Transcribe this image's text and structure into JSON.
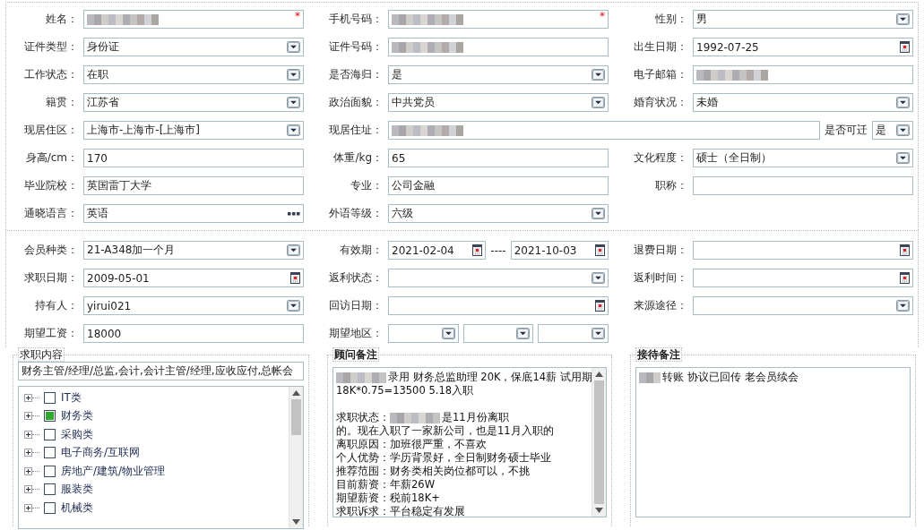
{
  "sections": [
    {
      "cells": [
        {
          "label": "姓名：",
          "controls": [
            {
              "kind": "text",
              "blurred": true,
              "required_mark": "*"
            }
          ]
        },
        {
          "label": "手机号码：",
          "controls": [
            {
              "kind": "text",
              "blurred": true,
              "required_mark": "*"
            }
          ]
        },
        {
          "label": "性别：",
          "controls": [
            {
              "kind": "select",
              "value": "男"
            }
          ]
        },
        {
          "label": "证件类型：",
          "controls": [
            {
              "kind": "select",
              "value": "身份证"
            }
          ]
        },
        {
          "label": "证件号码：",
          "controls": [
            {
              "kind": "text",
              "blurred": true
            }
          ]
        },
        {
          "label": "出生日期：",
          "controls": [
            {
              "kind": "date",
              "value": "1992-07-25"
            }
          ]
        },
        {
          "label": "工作状态：",
          "controls": [
            {
              "kind": "select",
              "value": "在职"
            }
          ]
        },
        {
          "label": "是否海归：",
          "controls": [
            {
              "kind": "select",
              "value": "是"
            }
          ]
        },
        {
          "label": "电子邮箱：",
          "controls": [
            {
              "kind": "text",
              "blurred": true
            }
          ]
        },
        {
          "label": "籍贯：",
          "controls": [
            {
              "kind": "select",
              "value": "江苏省"
            }
          ]
        },
        {
          "label": "政治面貌：",
          "controls": [
            {
              "kind": "select",
              "value": "中共党员"
            }
          ]
        },
        {
          "label": "婚育状况：",
          "controls": [
            {
              "kind": "select",
              "value": "未婚"
            }
          ]
        },
        {
          "label": "现居住区：",
          "controls": [
            {
              "kind": "select",
              "value": "上海市-上海市-[上海市]"
            }
          ]
        },
        {
          "label": "现居住址：",
          "wide": true,
          "controls": [
            {
              "kind": "text",
              "blurred": true
            },
            {
              "kind": "label",
              "text": "是否可迁"
            },
            {
              "kind": "select",
              "value": "是",
              "compact": true
            }
          ]
        },
        {
          "label": "身高/cm：",
          "controls": [
            {
              "kind": "text",
              "value": "170"
            }
          ]
        },
        {
          "label": "体重/kg：",
          "controls": [
            {
              "kind": "text",
              "value": "65"
            }
          ]
        },
        {
          "label": "文化程度：",
          "controls": [
            {
              "kind": "select",
              "value": "硕士（全日制）"
            }
          ]
        },
        {
          "label": "毕业院校：",
          "controls": [
            {
              "kind": "text",
              "value": "英国雷丁大学"
            }
          ]
        },
        {
          "label": "专业：",
          "controls": [
            {
              "kind": "text",
              "value": "公司金融"
            }
          ]
        },
        {
          "label": "职称：",
          "controls": [
            {
              "kind": "text"
            }
          ]
        },
        {
          "label": "通晓语言：",
          "controls": [
            {
              "kind": "lookup",
              "value": "英语"
            }
          ]
        },
        {
          "label": "外语等级：",
          "controls": [
            {
              "kind": "select",
              "value": "六级"
            }
          ]
        }
      ]
    },
    {
      "cells": [
        {
          "label": "会员种类：",
          "controls": [
            {
              "kind": "select",
              "value": "21-A348加一个月"
            }
          ]
        },
        {
          "label": "有效期：",
          "controls": [
            {
              "kind": "date",
              "value": "2021-02-04"
            },
            {
              "kind": "label",
              "text": "----"
            },
            {
              "kind": "date",
              "value": "2021-10-03"
            }
          ]
        },
        {
          "label": "退费日期：",
          "controls": [
            {
              "kind": "date"
            }
          ]
        },
        {
          "label": "求职日期：",
          "controls": [
            {
              "kind": "date",
              "value": "2009-05-01"
            }
          ]
        },
        {
          "label": "返利状态：",
          "controls": [
            {
              "kind": "select"
            }
          ]
        },
        {
          "label": "返利时间：",
          "controls": [
            {
              "kind": "date"
            }
          ]
        },
        {
          "label": "持有人：",
          "controls": [
            {
              "kind": "select",
              "value": "yirui021"
            }
          ]
        },
        {
          "label": "回访日期：",
          "controls": [
            {
              "kind": "date"
            }
          ]
        },
        {
          "label": "来源途径：",
          "controls": [
            {
              "kind": "select"
            }
          ]
        },
        {
          "label": "期望工资：",
          "controls": [
            {
              "kind": "text",
              "value": "18000"
            }
          ]
        },
        {
          "label": "期望地区：",
          "controls": [
            {
              "kind": "select"
            },
            {
              "kind": "select"
            },
            {
              "kind": "select"
            }
          ]
        }
      ]
    }
  ],
  "job_content": {
    "title": "求职内容",
    "summary": "财务主管/经理/总监,会计,会计主管/经理,应收应付,总帐会",
    "tree": [
      {
        "label": "IT类",
        "checked": false,
        "expanded": false
      },
      {
        "label": "财务类",
        "checked": true,
        "expanded": false
      },
      {
        "label": "采购类",
        "checked": false,
        "expanded": false
      },
      {
        "label": "电子商务/互联网",
        "checked": false,
        "expanded": false
      },
      {
        "label": "房地产/建筑/物业管理",
        "checked": false,
        "expanded": false
      },
      {
        "label": "服装类",
        "checked": false,
        "expanded": false
      },
      {
        "label": "机械类",
        "checked": false,
        "expanded": false
      }
    ]
  },
  "advisor_notes": {
    "title": "顾问备注",
    "lines": [
      {
        "kind": "text",
        "parts": [
          {
            "kind": "blur"
          },
          {
            "kind": "text",
            "text": "录用 财务总监助理  20K，保底14薪 试用期"
          }
        ]
      },
      {
        "kind": "text",
        "parts": [
          {
            "kind": "text",
            "text": "18K*0.75=13500  5.18入职"
          }
        ]
      },
      {
        "kind": "blank"
      },
      {
        "kind": "text",
        "parts": [
          {
            "kind": "text",
            "text": "求职状态："
          },
          {
            "kind": "blur"
          },
          {
            "kind": "text",
            "text": "是11月份离职"
          }
        ]
      },
      {
        "kind": "text",
        "parts": [
          {
            "kind": "text",
            "text": "的。现在入职了一家新公司，也是11月入职的"
          }
        ]
      },
      {
        "kind": "text",
        "parts": [
          {
            "kind": "text",
            "text": "离职原因：加班很严重，不喜欢"
          }
        ]
      },
      {
        "kind": "text",
        "parts": [
          {
            "kind": "text",
            "text": "个人优势：学历背景好，全日制财务硕士毕业"
          }
        ]
      },
      {
        "kind": "text",
        "parts": [
          {
            "kind": "text",
            "text": "推荐范围：财务类相关岗位都可以，不挑"
          }
        ]
      },
      {
        "kind": "text",
        "parts": [
          {
            "kind": "text",
            "text": "目前薪资：年薪26W"
          }
        ]
      },
      {
        "kind": "text",
        "parts": [
          {
            "kind": "text",
            "text": "期望薪资：税前18K+"
          }
        ]
      },
      {
        "kind": "text",
        "parts": [
          {
            "kind": "text",
            "text": "求职诉求：平台稳定有发展"
          }
        ]
      }
    ]
  },
  "reception_notes": {
    "title": "接待备注",
    "lines": [
      {
        "kind": "text",
        "parts": [
          {
            "kind": "blur"
          },
          {
            "kind": "text",
            "text": "转账 协议已回传 老会员续会"
          }
        ]
      }
    ]
  }
}
